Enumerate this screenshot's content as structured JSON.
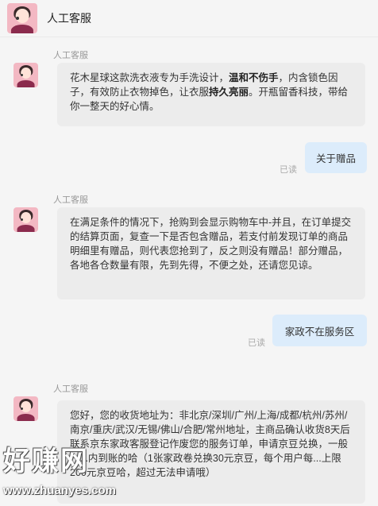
{
  "header": {
    "title": "人工客服"
  },
  "messages": [
    {
      "sender": "人工客服",
      "parts": [
        "花木星球这款洗衣液专为手洗设计，",
        "温和不伤手",
        "，内含锁色因子，有效防止衣物掉色，让衣服",
        "持久亮丽",
        "。开瓶留香科技，带给你一整天的好心情。"
      ]
    },
    {
      "text": "关于赠品",
      "status": "已读"
    },
    {
      "sender": "人工客服",
      "text": "在满足条件的情况下，抢购到会显示购物车中-并且，在订单提交的结算页面，复查一下是否包含赠品，若支付前发现订单的商品明细里有赠品，则代表您抢到了，反之则没有赠品！部分赠品，各地各仓数量有限，先到先得，不便之处，还请您见谅。"
    },
    {
      "text": "家政不在服务区",
      "status": "已读"
    },
    {
      "sender": "人工客服",
      "text": "您好，您的收货地址为：非北京/深圳/广州/上海/成都/杭州/苏州/南京/重庆/武汉/无锡/佛山/合肥/常州地址，主商品确认收货8天后联系京东家政客服登记作废您的服务订单，申请京豆兑换，一般一...内到账的哈（1张家政卷兑换30元京豆，每个用户每...上限200元京豆哈，超过无法申请哦）"
    }
  ],
  "watermark": {
    "text": "好赚网",
    "url": "www.zhuanyes.com"
  }
}
